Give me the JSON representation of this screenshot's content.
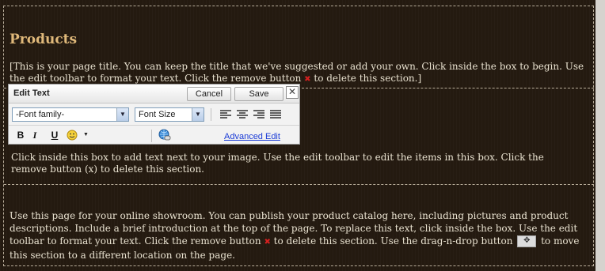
{
  "section": {
    "title": "Products",
    "title_text_before_remove": "[This is your page title. You can keep the title that we've suggested or add your own. Click inside the box to begin. Use the edit toolbar to format your text. Click the remove button ",
    "title_text_after_remove": " to delete this section.]",
    "image_text": "Click inside this box to add text next to your image. Use the edit toolbar to edit the items in this box. Click the remove button (x) to delete this section.",
    "body_text_1": "Use this page for your online showroom. You can publish your product catalog here, including pictures and product descriptions. Include a brief introduction at the top of the page. To replace this text, click inside the box. Use the edit toolbar to format your text. Click the remove button ",
    "body_text_2": " to delete this section. Use the drag-n-drop button ",
    "body_text_3": " to move this section to a different location on the page.",
    "remove_glyph": "✖",
    "drag_glyph": "✥"
  },
  "editor": {
    "title": "Edit Text",
    "cancel_label": "Cancel",
    "save_label": "Save",
    "close_glyph": "✕",
    "font_family_value": "-Font family-",
    "font_size_value": "Font Size",
    "bold_glyph": "B",
    "italic_glyph": "I",
    "underline_glyph": "U",
    "advanced_edit_label": "Advanced Edit"
  },
  "colors": {
    "background": "#241a10",
    "title": "#e0b97a",
    "text": "#e9e2d0",
    "remove": "#d42020",
    "link": "#1a3bd6"
  }
}
